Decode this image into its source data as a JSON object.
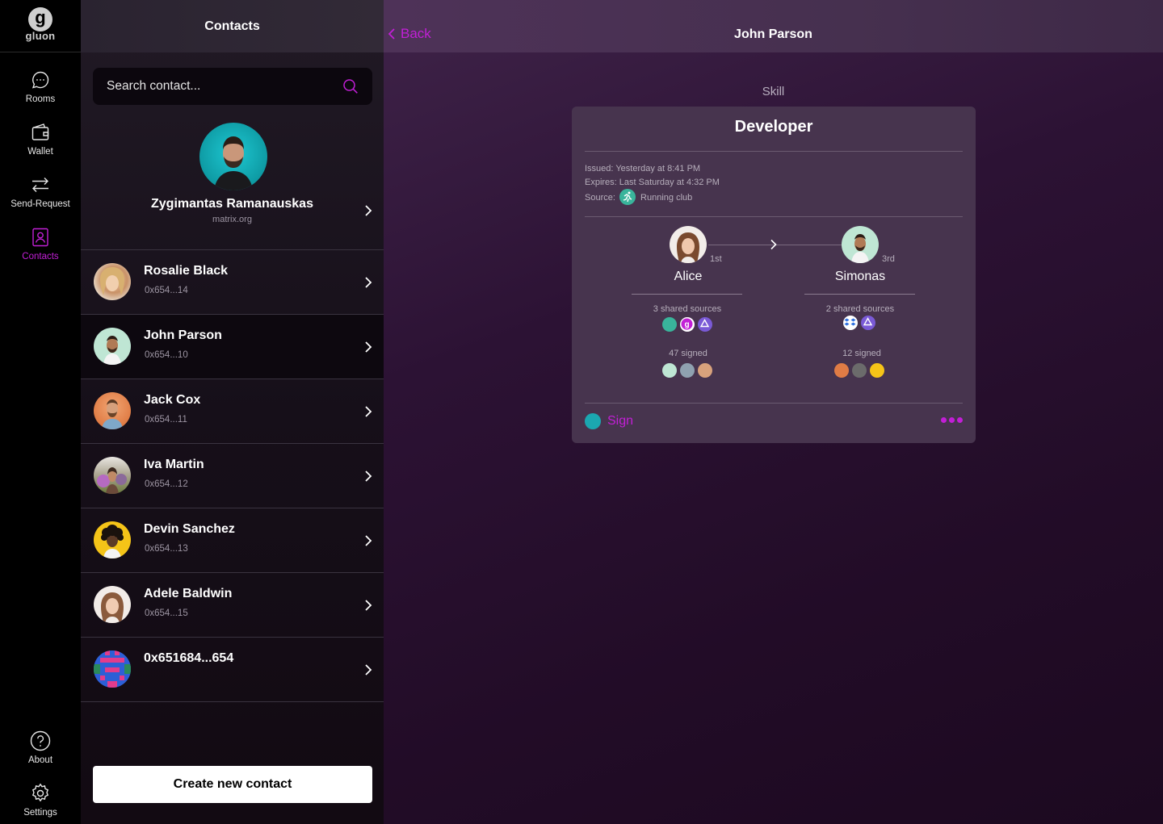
{
  "app": {
    "logo_letter": "g",
    "logo_word": "gluon",
    "accent": "#c21fd6"
  },
  "nav": {
    "rooms": "Rooms",
    "wallet": "Wallet",
    "send_request": "Send-Request",
    "contacts": "Contacts",
    "about": "About",
    "settings": "Settings",
    "active": "Contacts"
  },
  "contacts_panel": {
    "title": "Contacts",
    "search_placeholder": "Search contact...",
    "me": {
      "name": "Zygimantas Ramanauskas",
      "server": "matrix.org"
    },
    "items": [
      {
        "name": "Rosalie Black",
        "address": "0x654...14"
      },
      {
        "name": "John Parson",
        "address": "0x654...10",
        "selected": true
      },
      {
        "name": "Jack Cox",
        "address": "0x654...11"
      },
      {
        "name": "Iva Martin",
        "address": "0x654...12"
      },
      {
        "name": "Devin Sanchez",
        "address": "0x654...13"
      },
      {
        "name": "Adele Baldwin",
        "address": "0x654...15"
      },
      {
        "name": "0x651684...654",
        "address": ""
      }
    ],
    "create_button": "Create new contact"
  },
  "detail": {
    "back_label": "Back",
    "title": "John Parson",
    "section_label": "Skill",
    "card": {
      "title": "Developer",
      "issued": "Issued: Yesterday at 8:41 PM",
      "expires": "Expires: Last Saturday at 4:32 PM",
      "source_label": "Source:",
      "source_name": "Running club",
      "chain": [
        {
          "name": "Alice",
          "rank": "1st",
          "shared_sources": "3 shared sources",
          "signed": "47 signed"
        },
        {
          "name": "Simonas",
          "rank": "3rd",
          "shared_sources": "2 shared sources",
          "signed": "12 signed"
        }
      ],
      "sign_label": "Sign"
    }
  }
}
